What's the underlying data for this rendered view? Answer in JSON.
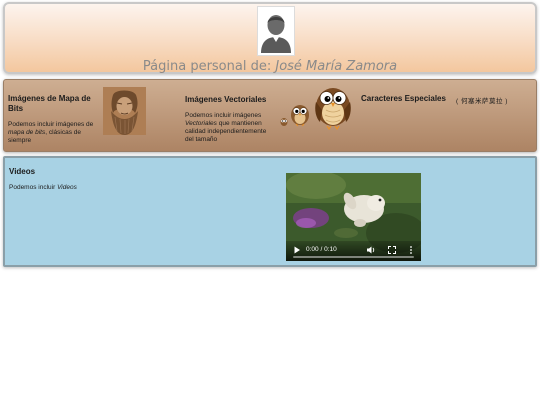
{
  "header": {
    "title_prefix": "Página personal de:",
    "owner_name": "José María Zamora"
  },
  "sections": {
    "bitmap": {
      "title": "Imágenes de Mapa de Bits",
      "desc_1": "Podemos incluir imágenes de",
      "desc_em": "mapa de bits",
      "desc_2": ", clásicas de siempre"
    },
    "vector": {
      "title": "Imágenes Vectoriales",
      "desc_1": "Podemos incluir imágenes",
      "desc_em": "Vectoriales",
      "desc_2": " que mantienen calidad independientemente del tamaño"
    },
    "chars": {
      "title": "Caracteres Especiales",
      "sample": "( 何塞米萨莫拉 )"
    }
  },
  "video": {
    "title": "Videos",
    "desc_1": "Podemos incluir",
    "desc_em": "Videos",
    "time": "0:00 / 0:10",
    "progress": 0
  },
  "colors": {
    "header_top": "#fdf4ee",
    "header_bottom": "#f3c79e",
    "band_top": "#ceae92",
    "band_bottom": "#ad8464",
    "video_panel": "#a8d2e4"
  },
  "icons": {
    "avatar": "user-avatar-icon",
    "play": "play-icon",
    "volume": "volume-icon",
    "fullscreen": "fullscreen-icon",
    "more": "more-options-icon"
  }
}
